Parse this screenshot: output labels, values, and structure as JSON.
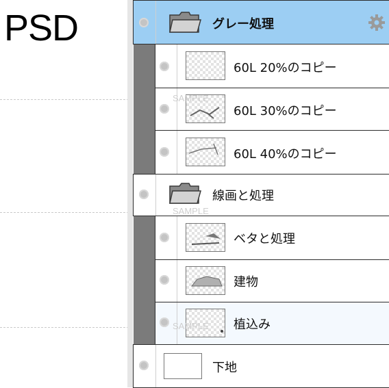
{
  "format_label": "PSD",
  "watermark": "SAMPLE",
  "layers": [
    {
      "name": "グレー処理",
      "kind": "folder",
      "selected": true,
      "settings_icon": "gear-icon"
    },
    {
      "name": "60L 20%のコピー",
      "kind": "layer"
    },
    {
      "name": "60L 30%のコピー",
      "kind": "layer"
    },
    {
      "name": "60L 40%のコピー",
      "kind": "layer"
    },
    {
      "name": "線画と処理",
      "kind": "folder"
    },
    {
      "name": "ベタと処理",
      "kind": "layer"
    },
    {
      "name": "建物",
      "kind": "layer"
    },
    {
      "name": "植込み",
      "kind": "layer"
    },
    {
      "name": "下地",
      "kind": "layer"
    }
  ],
  "colors": {
    "selected_row": "#9ccef3",
    "indent_bar": "#7b7b7b",
    "eye_dot": "#c4c4c4"
  }
}
